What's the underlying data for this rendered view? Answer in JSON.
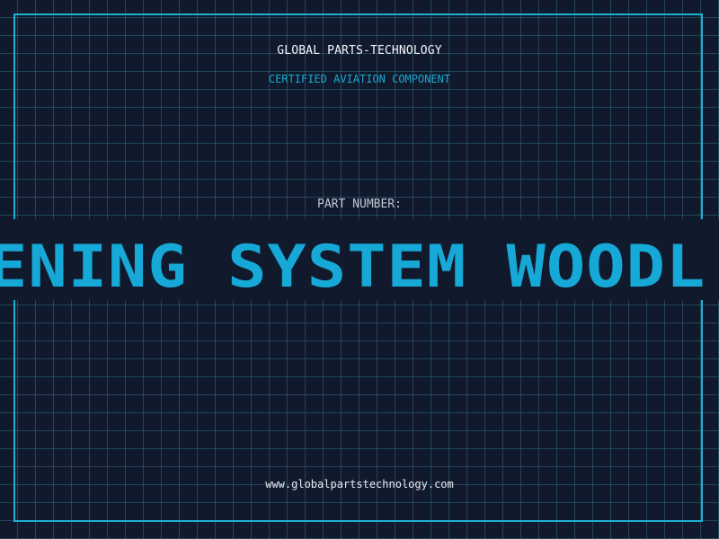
{
  "company": {
    "name": "GLOBAL PARTS-TECHNOLOGY",
    "tagline": "CERTIFIED AVIATION COMPONENT"
  },
  "part": {
    "label": "PART NUMBER:",
    "value": "ENING SYSTEM WOODL"
  },
  "footer": {
    "website": "www.globalpartstechnology.com"
  },
  "colors": {
    "background": "#111a2d",
    "grid": "#367695",
    "accent": "#1db0d2",
    "text": "#f5f7fb"
  }
}
